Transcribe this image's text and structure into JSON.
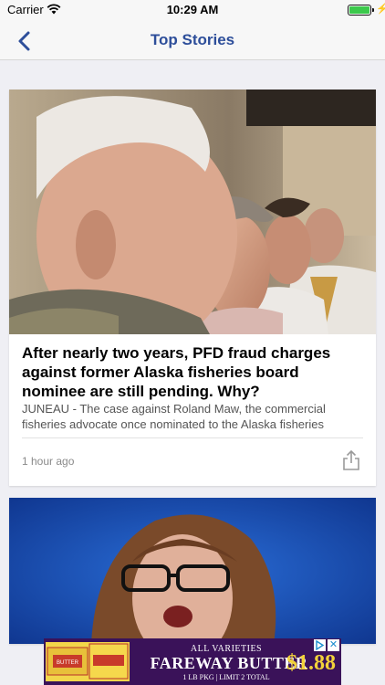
{
  "status_bar": {
    "carrier": "Carrier",
    "time": "10:29 AM",
    "battery_level": 1.0,
    "battery_color": "#3cc94c"
  },
  "nav": {
    "title": "Top Stories",
    "accent_color": "#2d4e9a",
    "back_icon": "chevron-left-icon"
  },
  "stories": [
    {
      "image": "photo of older men seated in a row, profile view",
      "headline": "After nearly two years, PFD fraud charges against former Alaska fisheries board nominee are still pending. Why?",
      "excerpt": "JUNEAU - The case against Roland Maw, the commercial fisheries advocate once nominated to the Alaska fisheries",
      "time": "1 hour ago",
      "share_icon": "share-icon"
    },
    {
      "image": "photo of woman with glasses speaking at podium, blue background"
    }
  ],
  "ad": {
    "top_line": "ALL VARIETIES",
    "main": "FAREWAY BUTTER",
    "sub": "1 LB PKG | LIMIT 2 TOTAL",
    "price": "$1.88",
    "price_color": "#f3d23a",
    "package_label": "BUTTER"
  }
}
